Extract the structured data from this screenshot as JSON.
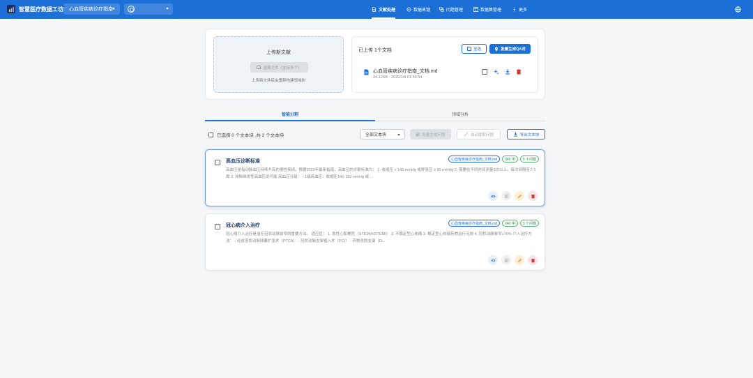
{
  "app": {
    "title": "智慧医疗数据工坊"
  },
  "header": {
    "project_select": "心血管疾病诊疗指南",
    "nav": [
      {
        "label": "文献处理",
        "icon": "document-icon",
        "active": true
      },
      {
        "label": "数据蒸馏",
        "icon": "distill-icon",
        "active": false
      },
      {
        "label": "问题管理",
        "icon": "chat-icon",
        "active": false
      },
      {
        "label": "数据集管理",
        "icon": "dataset-icon",
        "active": false
      },
      {
        "label": "更多",
        "icon": "more-vertical-icon",
        "active": false
      }
    ]
  },
  "upload": {
    "title": "上传新文献",
    "select_button": "选择文件（支持多个）",
    "hint": "上传新文件后会重新构建领域树"
  },
  "files": {
    "count_label": "已上传 1个文档",
    "select_all": "全选",
    "batch_generate": "批量生成QA对",
    "items": [
      {
        "name": "心血管疾病诊疗指南_文档.md",
        "meta": "34.12KB · 2026/1/8 01:59:54"
      }
    ]
  },
  "tabs": [
    {
      "label": "智能分割",
      "active": true
    },
    {
      "label": "领域分析",
      "active": false
    }
  ],
  "toolbar": {
    "selection_text": "已选择 0 个文本块 ,共 2 个文本块",
    "filter": "全部文本块",
    "batch_questions": "批量生成问题",
    "auto_extract": "自动提取问题",
    "export": "导出文本块"
  },
  "chunks": [
    {
      "title": "高血压诊断标准",
      "source": "心血管疾病诊疗指南_文档.md",
      "chars": "345 字",
      "questions": "5 个问题",
      "text": "高血压是指动脉血压持续升高的慢性疾病。根据2023年最新指南，高血压的诊断标准为：  1. 收缩压 ≥ 140 mmHg 或舒张压 ≥ 90 mmHg 2. 需要在不同时间测量3次以上，每次间隔至少1周 3. 排除继发性高血压的可能  高血压分级：  - 1级高血压：收缩压140-159 mmHg 或 ..."
    },
    {
      "title": "冠心病介入治疗",
      "source": "心血管疾病诊疗指南_文档.md",
      "chars": "240 字",
      "questions": "3 个问题",
      "text": "冠心病介入治疗是治疗冠状动脉狭窄的重要方法。 适应症：  1. 急性心肌梗死（STEMI/NSTEMI） 2. 不稳定型心绞痛 3. 稳定型心绞痛药物治疗无效 4. 冠状动脉狭窄≥70%  介入治疗方法：  - 经皮冠状动脉球囊扩张术（PTCA） - 冠状动脉支架植入术（PCI） - 药物洗脱支架（D..."
    }
  ],
  "colors": {
    "primary": "#1b6fd6",
    "success": "#2f8c46",
    "danger": "#d32f2f",
    "warning": "#f2a23a"
  }
}
